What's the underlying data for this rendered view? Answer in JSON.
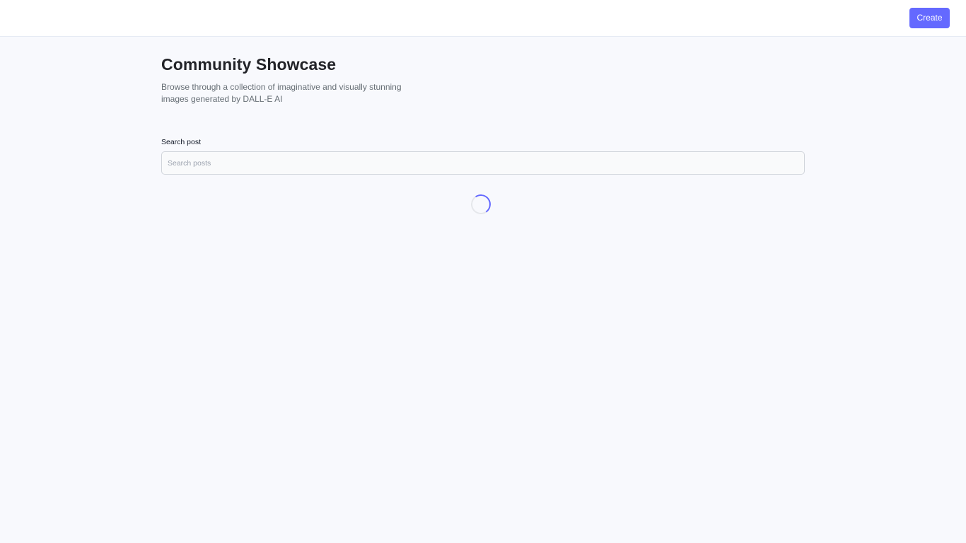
{
  "header": {
    "create_label": "Create"
  },
  "main": {
    "title": "Community Showcase",
    "subtitle": "Browse through a collection of imaginative and visually stunning images generated by DALL-E AI",
    "search": {
      "label": "Search post",
      "placeholder": "Search posts",
      "value": ""
    }
  },
  "colors": {
    "accent": "#6469ff",
    "page_background": "#f8f9fd",
    "header_background": "#ffffff"
  },
  "icons": {
    "loader": "loading-spinner-icon"
  }
}
